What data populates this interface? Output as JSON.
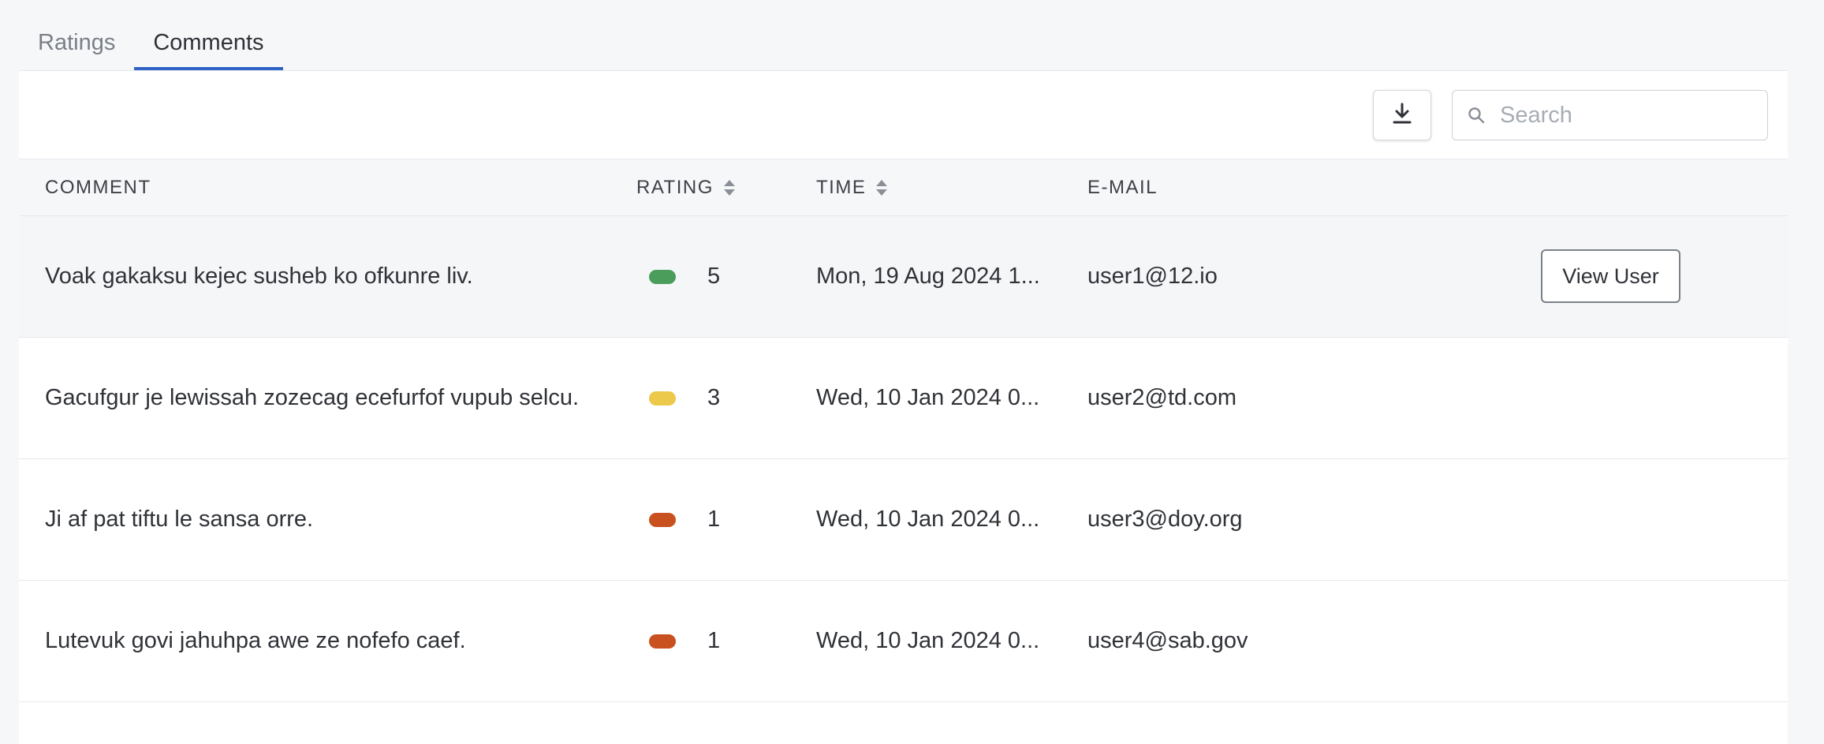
{
  "tabs": [
    {
      "label": "Ratings",
      "active": false
    },
    {
      "label": "Comments",
      "active": true
    }
  ],
  "search": {
    "placeholder": "Search",
    "value": ""
  },
  "columns": {
    "comment": "COMMENT",
    "rating": "RATING",
    "time": "TIME",
    "email": "E-MAIL"
  },
  "rating_colors": {
    "5": "#4a9d5b",
    "3": "#ecc94b",
    "1": "#c9501f"
  },
  "rows": [
    {
      "comment": "Voak gakaksu kejec susheb ko ofkunre liv.",
      "rating": "5",
      "color": "#4a9d5b",
      "time": "Mon, 19 Aug 2024 1...",
      "email": "user1@12.io",
      "action": "View User"
    },
    {
      "comment": "Gacufgur je lewissah zozecag ecefurfof vupub selcu.",
      "rating": "3",
      "color": "#ecc94b",
      "time": "Wed, 10 Jan 2024 0...",
      "email": "user2@td.com"
    },
    {
      "comment": "Ji af pat tiftu le sansa orre.",
      "rating": "1",
      "color": "#c9501f",
      "time": "Wed, 10 Jan 2024 0...",
      "email": "user3@doy.org"
    },
    {
      "comment": "Lutevuk govi jahuhpa awe ze nofefo caef.",
      "rating": "1",
      "color": "#c9501f",
      "time": "Wed, 10 Jan 2024 0...",
      "email": "user4@sab.gov"
    }
  ]
}
